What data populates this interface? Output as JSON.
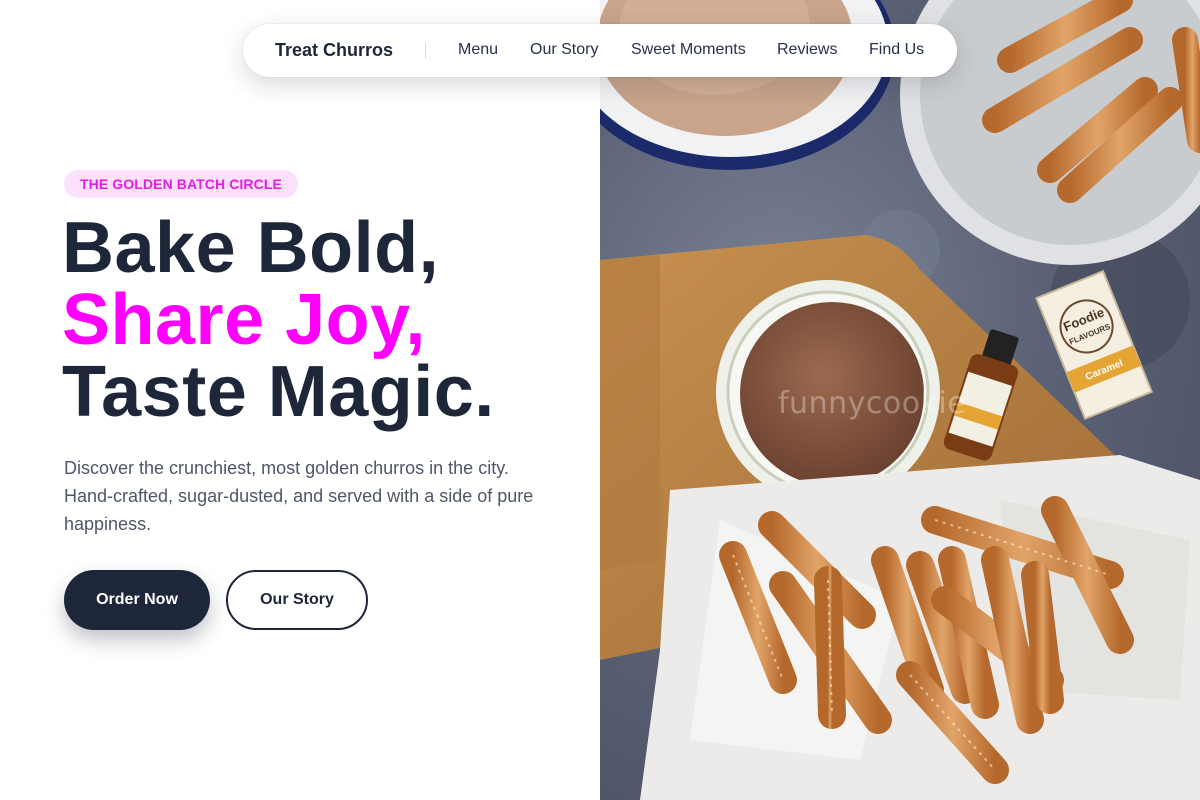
{
  "nav": {
    "brand": "Treat Churros",
    "links": [
      "Menu",
      "Our Story",
      "Sweet Moments",
      "Reviews",
      "Find Us"
    ]
  },
  "hero": {
    "badge": "THE GOLDEN BATCH CIRCLE",
    "headline_line1": "Bake Bold,",
    "headline_line2": "Share Joy,",
    "headline_line3": "Taste Magic.",
    "description": "Discover the crunchiest, most golden churros in the city. Hand-crafted, sugar-dusted, and served with a side of pure happiness.",
    "primary_button": "Order Now",
    "secondary_button": "Our Story"
  },
  "photo": {
    "watermark": "funnycookie",
    "label_brand": "Foodie",
    "label_brand_line2": "FLAVOURS",
    "label_flavour": "Caramel"
  },
  "colors": {
    "accent_pink": "#ff00ff",
    "badge_bg": "#fde0fb",
    "badge_text": "#e41de6",
    "dark_navy": "#1e2639"
  }
}
